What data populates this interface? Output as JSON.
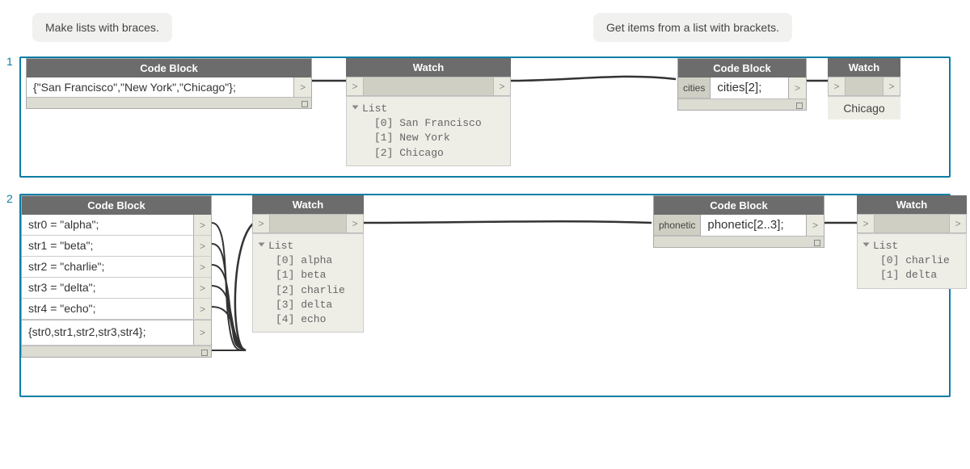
{
  "callouts": {
    "left": "Make lists with braces.",
    "right": "Get items from a list with brackets."
  },
  "labels": {
    "one": "1",
    "two": "2"
  },
  "node_titles": {
    "code_block": "Code Block",
    "watch": "Watch"
  },
  "r1": {
    "cb1_code": "{\"San Francisco\",\"New York\",\"Chicago\"};",
    "watch1_head": "List",
    "watch1_items": {
      "a": "[0] San Francisco",
      "b": "[1] New York",
      "c": "[2] Chicago"
    },
    "cb2_port": "cities",
    "cb2_code": "cities[2];",
    "watch2_value": "Chicago"
  },
  "r2": {
    "cb1_lines": {
      "l0": "str0 = \"alpha\";",
      "l1": "str1 = \"beta\";",
      "l2": "str2 = \"charlie\";",
      "l3": "str3 = \"delta\";",
      "l4": "str4 = \"echo\";",
      "l5": "{str0,str1,str2,str3,str4};"
    },
    "watch1_head": "List",
    "watch1_items": {
      "a": "[0] alpha",
      "b": "[1] beta",
      "c": "[2] charlie",
      "d": "[3] delta",
      "e": "[4] echo"
    },
    "cb2_port": "phonetic",
    "cb2_code": "phonetic[2..3];",
    "watch2_head": "List",
    "watch2_items": {
      "a": "[0] charlie",
      "b": "[1] delta"
    }
  }
}
